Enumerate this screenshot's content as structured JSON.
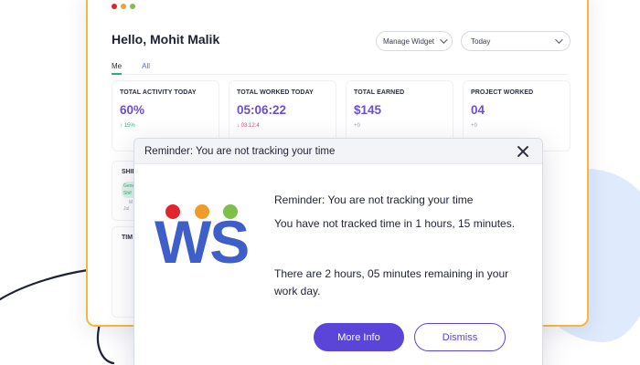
{
  "colors": {
    "accent": "#5b44d8",
    "value_purple": "#6a4fd0",
    "logo_blue": "#3e5ec9",
    "window_border": "#f5b73e",
    "green": "#2fae7a",
    "window_dots": [
      "#d9232d",
      "#f0a02c",
      "#7cc04a"
    ],
    "logo_dots": [
      "#e0262a",
      "#f09a2a",
      "#7cc04a"
    ]
  },
  "dashboard": {
    "greeting": "Hello, Mohit Malik",
    "manage_widget_label": "Manage Widget",
    "date_filter_value": "Today",
    "tabs": [
      {
        "label": "Me",
        "active": true
      },
      {
        "label": "All",
        "active": false
      }
    ],
    "stats": [
      {
        "label": "TOTAL ACTIVITY TODAY",
        "value": "60%",
        "sub": "↑ 15%"
      },
      {
        "label": "TOTAL WORKED TODAY",
        "value": "05:06:22",
        "sub": "↓ 03:12:4"
      },
      {
        "label": "TOTAL EARNED",
        "value": "$145",
        "sub": "+0"
      },
      {
        "label": "PROJECT WORKED",
        "value": "04",
        "sub": "+0"
      }
    ],
    "shift_panel": {
      "title": "SHIF",
      "pill_line1": "Gener",
      "pill_line2": "Shif",
      "line_m": "M",
      "line_jul": "Jul"
    },
    "time_panel_title": "TIM"
  },
  "reminder": {
    "header_title": "Reminder: You are not tracking your time",
    "logo_text": "WS",
    "message_title": "Reminder: You are not tracking your time",
    "message_line1": "You have not tracked time in 1 hours, 15 minutes.",
    "message_line2": "There are 2 hours, 05 minutes remaining in your work day.",
    "primary_button": "More Info",
    "secondary_button": "Dismiss",
    "close_icon": "close-icon"
  }
}
